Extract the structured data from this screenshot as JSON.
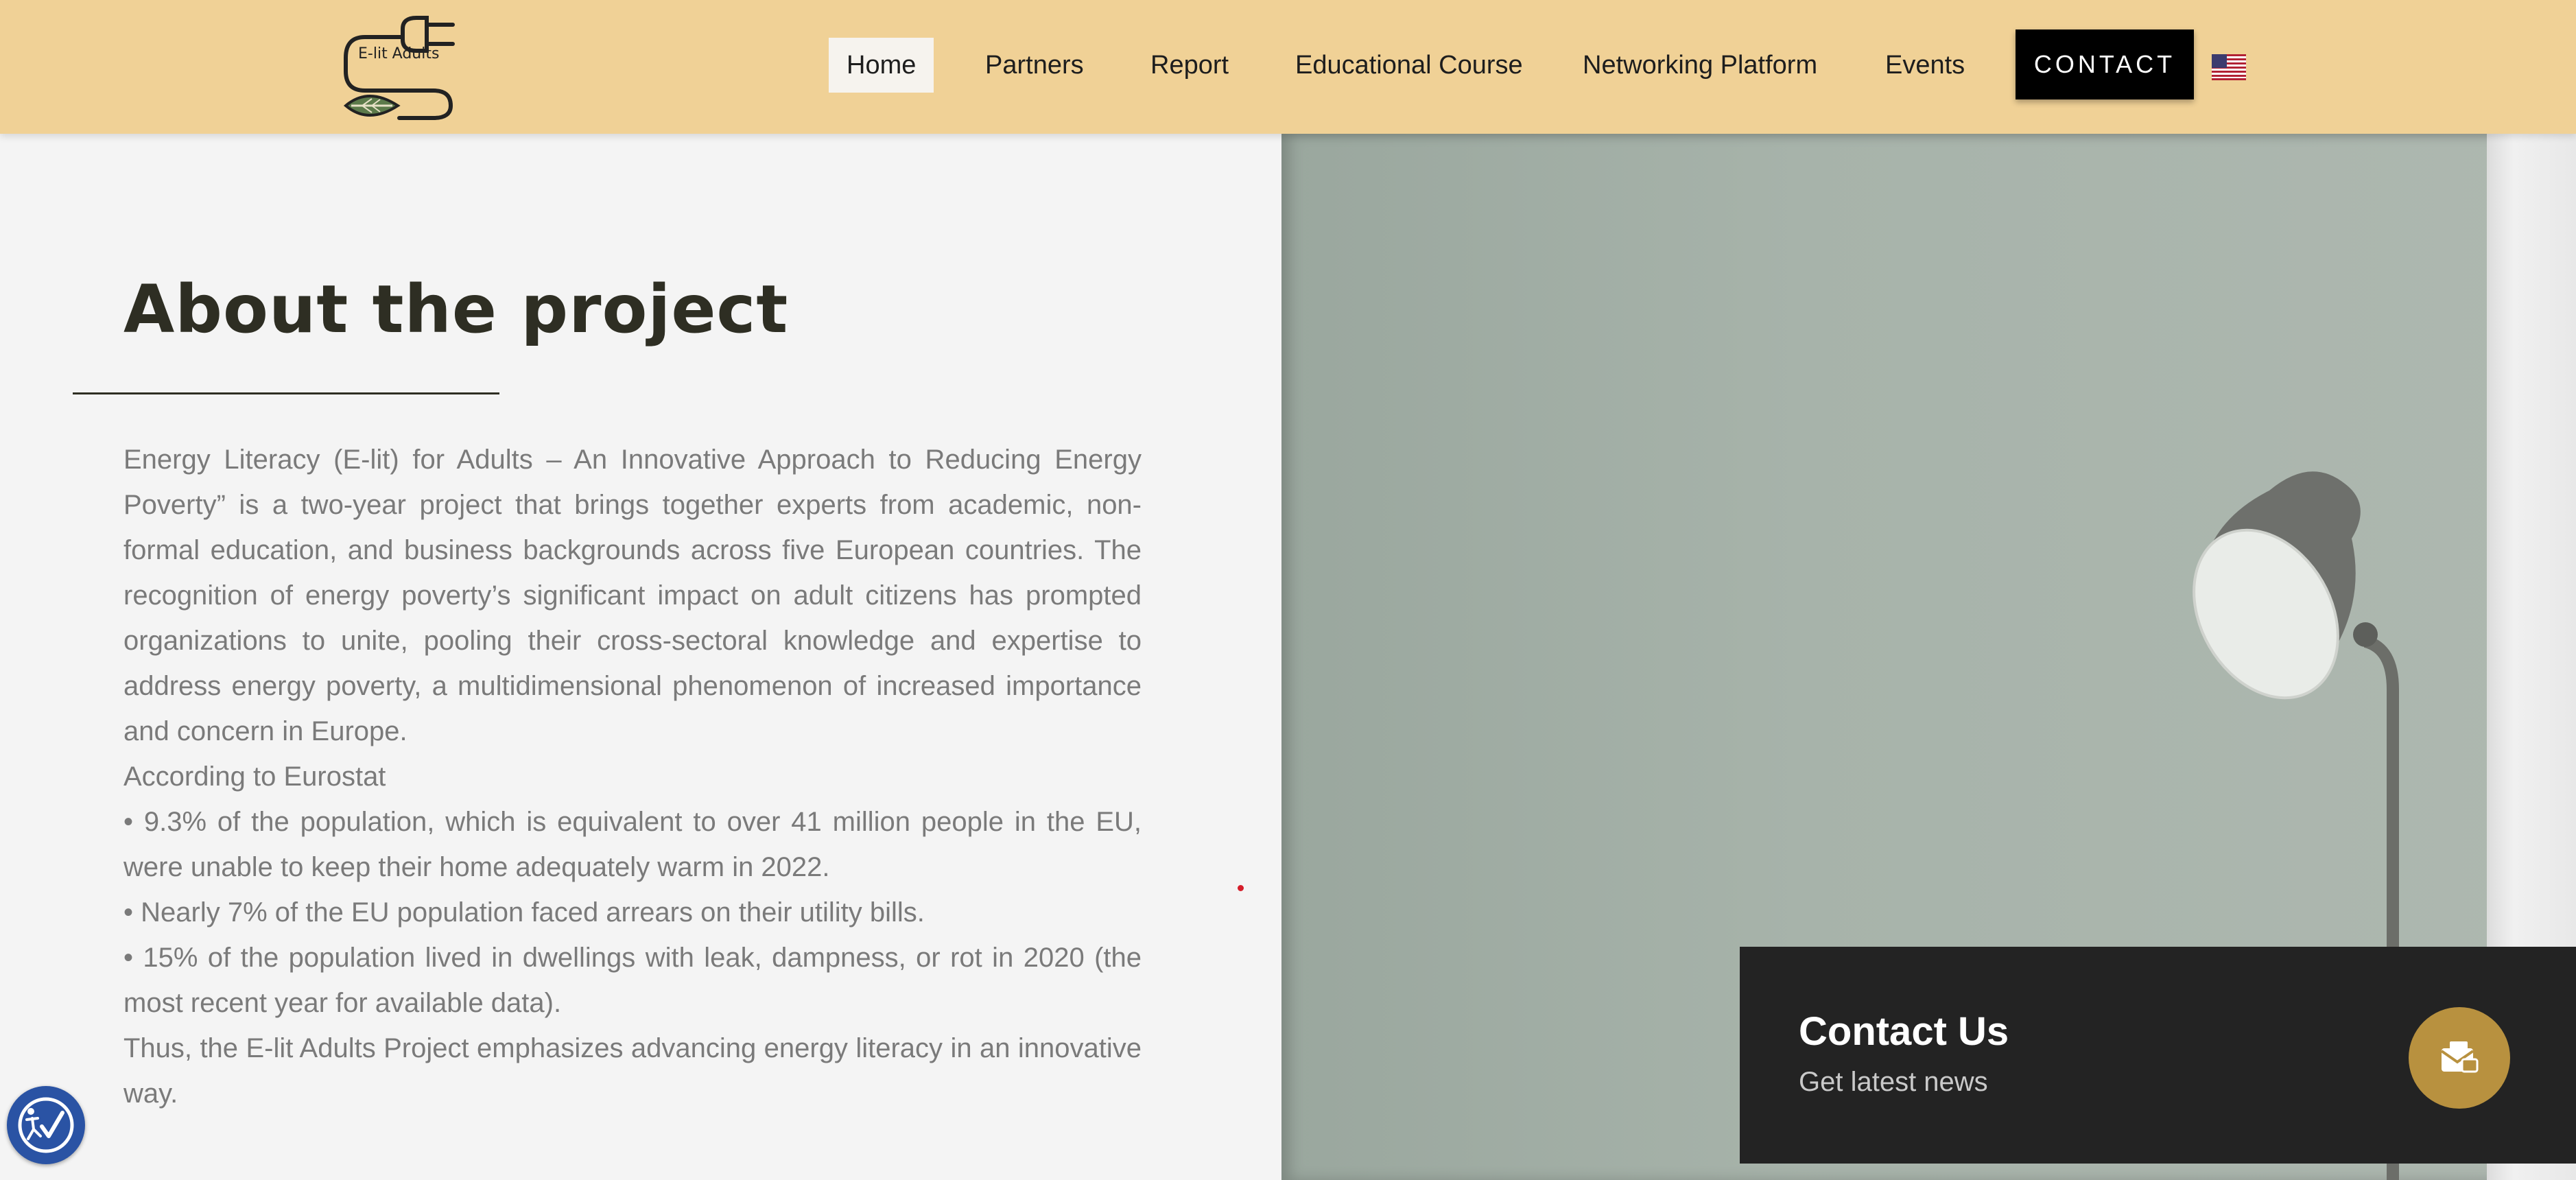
{
  "header": {
    "logo_text": "E-lit Adults",
    "nav": [
      {
        "label": "Home",
        "active": true
      },
      {
        "label": "Partners",
        "active": false
      },
      {
        "label": "Report",
        "active": false
      },
      {
        "label": "Educational Course",
        "active": false
      },
      {
        "label": "Networking Platform",
        "active": false
      },
      {
        "label": "Events",
        "active": false
      }
    ],
    "contact_label": "CONTACT",
    "language_icon": "us-flag-icon",
    "background_color": "#f0d196"
  },
  "about": {
    "title": "About the project",
    "paragraphs": [
      "Energy Literacy (E-lit) for Adults – An Innovative Approach to Reducing Energy Poverty” is a two-year project that brings together experts from academic, non-formal education, and business backgrounds across five European countries. The recognition of energy poverty’s significant impact on adult citizens has prompted organizations to unite, pooling their cross-sectoral knowledge and expertise to address energy poverty, a multidimensional phenomenon of increased importance and concern in Europe.",
      "According to Eurostat",
      "• 9.3% of the population, which is equivalent to over 41 million people in the EU, were unable to keep their home adequately warm in 2022.",
      "• Nearly 7% of the EU population faced arrears on their utility bills.",
      "• 15% of the population lived in dwellings with leak, dampness, or rot in 2020 (the most recent year for available data).",
      "Thus, the E-lit Adults Project emphasizes advancing energy literacy in an innovative way."
    ]
  },
  "contact_panel": {
    "title": "Contact Us",
    "subtitle": "Get latest news",
    "icon": "newsletter-icon",
    "accent_color": "#b8913f"
  },
  "accessibility": {
    "icon": "accessibility-icon",
    "color": "#2a53a4"
  }
}
